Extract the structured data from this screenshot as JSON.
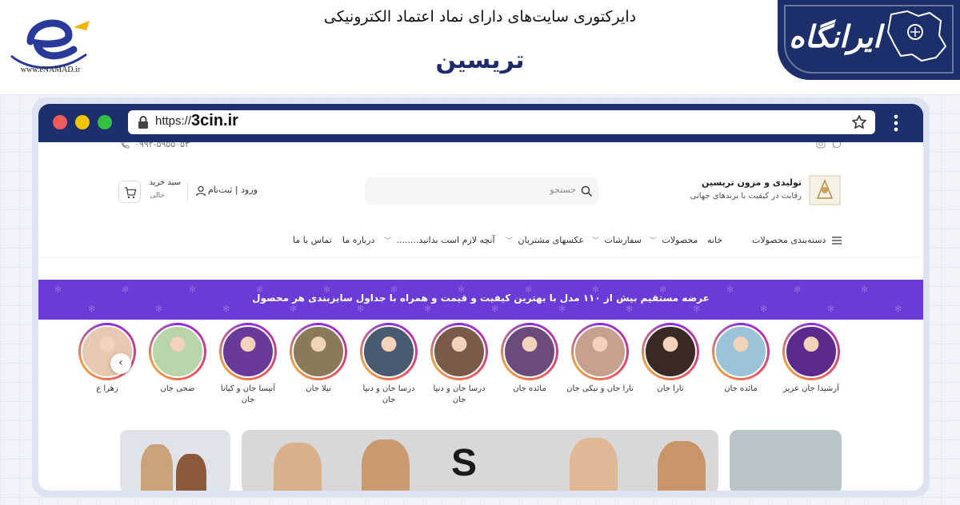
{
  "enamad": {
    "url": "www.eNAMAD.ir",
    "logo_letter": "e"
  },
  "heading": {
    "directory_title": "دایرکتوری سایت‌های دارای نماد اعتماد الکترونیکی",
    "site_name": "تریسین"
  },
  "irangah": {
    "logo_text": "ایرانگاه"
  },
  "browser": {
    "url_prefix": "https://",
    "url_domain": "3cin.ir"
  },
  "site": {
    "phone": "۰۹۹۲-۵۹۵۵۰۵۳",
    "brand_title": "تولیدی و مزون تریسین",
    "brand_subtitle": "رقابت در کیفیت با برندهای جهانی",
    "search_placeholder": "جستجو",
    "login_label": "ورود | ثبت‌نام",
    "cart_label": "سبد خرید",
    "cart_status": "خالی",
    "nav": {
      "categories": "دسته‌بندی محصولات",
      "home": "خانه",
      "products": "محصولات",
      "orders": "سفارشات",
      "customer_photos": "عکسهای مشتریان",
      "need_to_know": "آنچه لازم است بدانید........",
      "about": "درباره ما",
      "contact": "تماس با ما"
    },
    "banner_text": "عرضه مستقیم بیش از ۱۱۰ مدل با بهترین کیفیت و قیمت و همراه با جداول سایزبندی هر محصول",
    "stories": [
      {
        "label": "آرشیدا جان عزیز",
        "bg": "#5b2a8c"
      },
      {
        "label": "مائده جان",
        "bg": "#9cc4d8"
      },
      {
        "label": "تارا جان",
        "bg": "#3a2a24"
      },
      {
        "label": "تارا جان و نیکی جان",
        "bg": "#c7a08d"
      },
      {
        "label": "مائده جان",
        "bg": "#6d4a7e"
      },
      {
        "label": "درسا جان و دنیا جان",
        "bg": "#7a5a48"
      },
      {
        "label": "درسا جان و دنیا جان",
        "bg": "#4a5a70"
      },
      {
        "label": "نیلا جان",
        "bg": "#8a7a5a"
      },
      {
        "label": "آنیسا جان و کیانا جان",
        "bg": "#6a3a9a"
      },
      {
        "label": "ضحی جان",
        "bg": "#b8d4a8"
      },
      {
        "label": "زهرا ع",
        "bg": "#e8c8b0"
      }
    ]
  },
  "colors": {
    "chrome": "#1d2f6c",
    "banner": "#6a3bd6",
    "irangah": "#1c2f6b",
    "site_name": "#1e2a6e"
  }
}
